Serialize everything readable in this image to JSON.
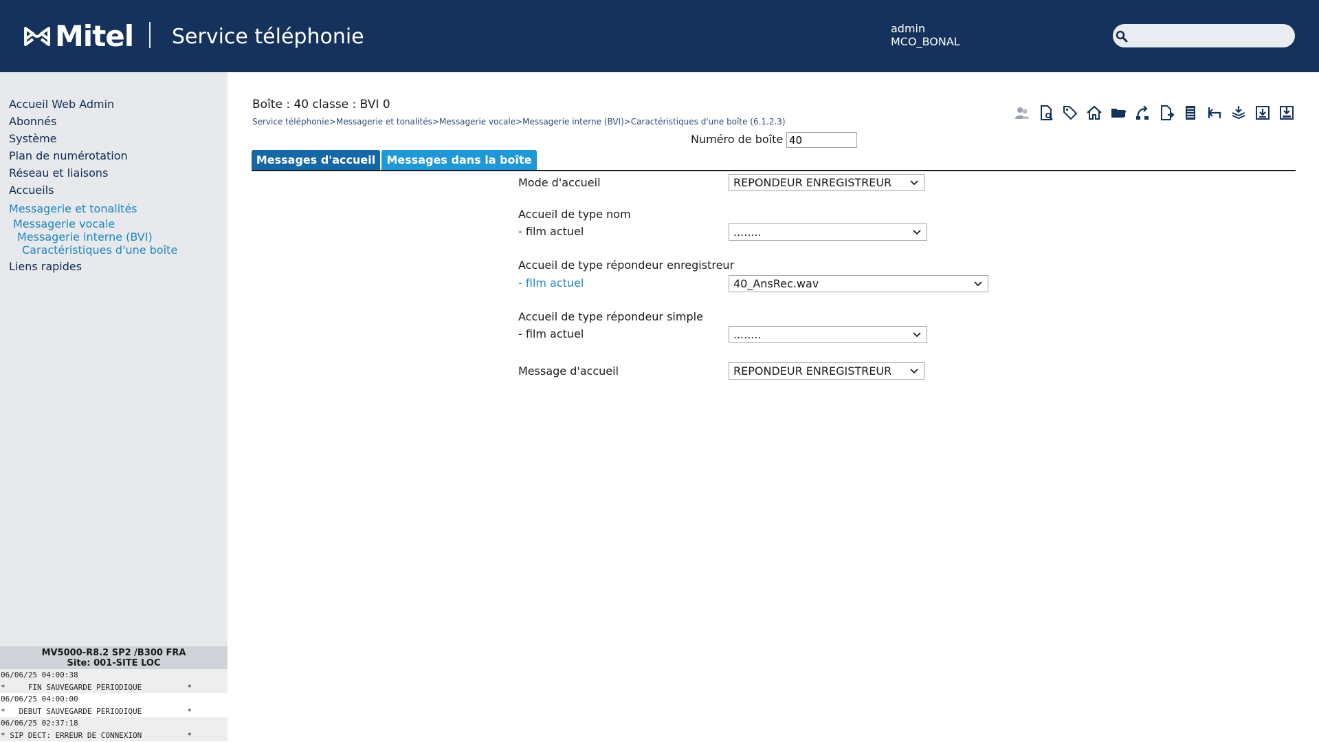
{
  "header": {
    "logo_text": "Mitel",
    "app_title": "Service téléphonie",
    "user": "admin",
    "site": "MCO_BONAL",
    "search_placeholder": ""
  },
  "sidebar": {
    "items": [
      {
        "label": "Accueil Web Admin"
      },
      {
        "label": "Abonnés"
      },
      {
        "label": "Système"
      },
      {
        "label": "Plan de numérotation"
      },
      {
        "label": "Réseau et liaisons"
      },
      {
        "label": "Accueils"
      },
      {
        "label": "Messagerie et tonalités"
      },
      {
        "label": "Messagerie vocale"
      },
      {
        "label": "Messagerie interne (BVI)"
      },
      {
        "label": "Caractéristiques d'une boîte"
      },
      {
        "label": "Liens rapides"
      }
    ],
    "status": {
      "version": "MV5000-R8.2 SP2 /B300 FRA",
      "site": "Site: 001-SITE LOC",
      "log": [
        "06/06/25 04:00:38",
        "*     FIN SAUVEGARDE PERIODIQUE          *",
        "06/06/25 04:00:00",
        "*   DEBUT SAUVEGARDE PERIODIQUE          *",
        "06/06/25 02:37:18",
        "* SIP DECT: ERREUR DE CONNEXION          *"
      ]
    }
  },
  "content": {
    "box_title": "Boîte : 40 classe : BVI 0",
    "breadcrumb": "Service téléphonie>Messagerie et tonalités>Messagerie vocale>Messagerie interne (BVI)>Caractéristiques d'une boîte (6.1.2.3)",
    "box_number_label": "Numéro de boîte",
    "box_number_value": "40",
    "tabs": [
      {
        "label": "Messages d'accueil"
      },
      {
        "label": "Messages dans la boîte"
      }
    ],
    "form": {
      "mode_label": "Mode d'accueil",
      "mode_value": "REPONDEUR ENREGISTREUR",
      "name_label": "Accueil de type nom",
      "name_film_label": "- film actuel",
      "name_film_value": "........",
      "ansrec_label": "Accueil de type répondeur enregistreur",
      "ansrec_film_label": "- film actuel",
      "ansrec_film_value": "40_AnsRec.wav",
      "simple_label": "Accueil de type répondeur simple",
      "simple_film_label": "- film actuel",
      "simple_film_value": "........",
      "message_label": "Message d'accueil",
      "message_value": "REPONDEUR ENREGISTREUR"
    },
    "toolbar_icons": [
      "users-icon",
      "document-search-icon",
      "tag-icon",
      "home-icon",
      "folder-upload-icon",
      "phone-transfer-icon",
      "document-arrow-icon",
      "list-icon",
      "back-arrow-icon",
      "stack-download-icon",
      "download-box-icon",
      "save-box-icon"
    ]
  },
  "colors": {
    "header_bg": "#15325c",
    "sidebar_bg": "#e7e9ec",
    "tab_active": "#1567a6",
    "tab_secondary": "#1e98d6",
    "link": "#1d86c0"
  }
}
